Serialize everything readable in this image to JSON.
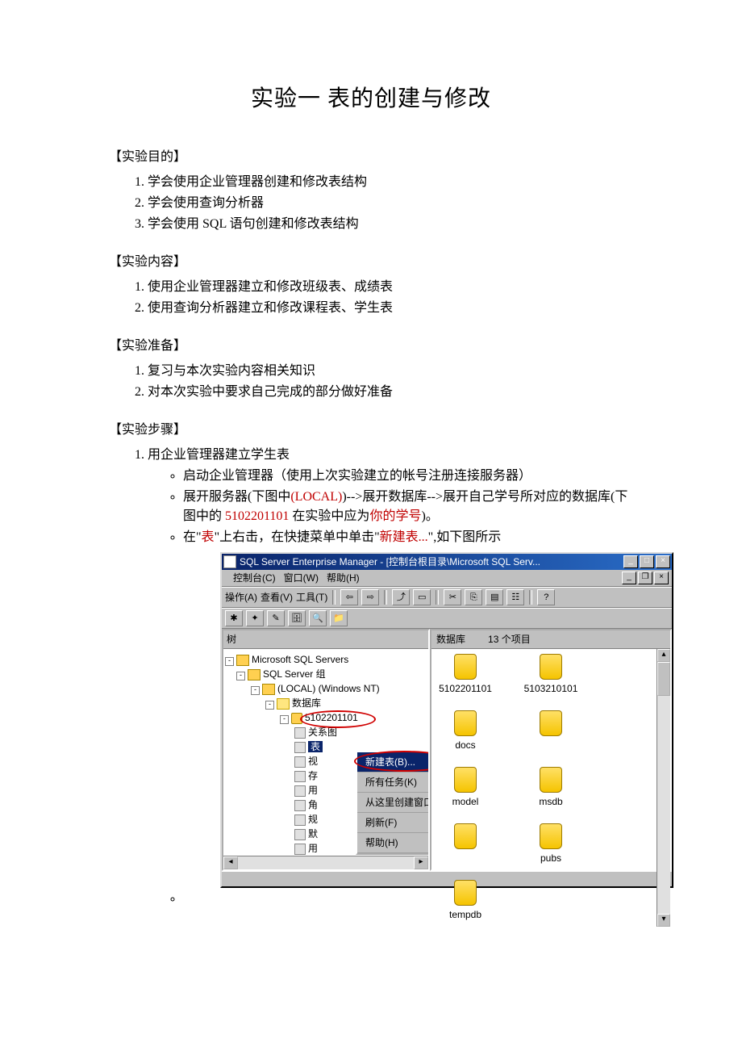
{
  "title": "实验一  表的创建与修改",
  "sections": {
    "purpose_head": "【实验目的】",
    "purpose": [
      "学会使用企业管理器创建和修改表结构",
      "学会使用查询分析器",
      "学会使用 SQL 语句创建和修改表结构"
    ],
    "content_head": "【实验内容】",
    "content": [
      "使用企业管理器建立和修改班级表、成绩表",
      "使用查询分析器建立和修改课程表、学生表"
    ],
    "prep_head": "【实验准备】",
    "prep": [
      "复习与本次实验内容相关知识",
      "对本次实验中要求自己完成的部分做好准备"
    ],
    "steps_head": "【实验步骤】",
    "step1": "用企业管理器建立学生表",
    "sub1": "启动企业管理器（使用上次实验建立的帐号注册连接服务器）",
    "sub2a": "展开服务器(下图中",
    "sub2b": "(LOCAL)",
    "sub2c": ")-->展开数据库-->展开自己学号所对应的数据库(下图中的 ",
    "sub2d": "5102201101",
    "sub2e": " 在实验中应为",
    "sub2f": "你的学号",
    "sub2g": ")。",
    "sub3a": "在\"",
    "sub3b": "表",
    "sub3c": "\"上右击，在快捷菜单中单击\"",
    "sub3d": "新建表...",
    "sub3e": "\",如下图所示"
  },
  "screenshot": {
    "titlebar": "SQL Server Enterprise Manager - [控制台根目录\\Microsoft SQL Serv...",
    "winbtn_min": "_",
    "winbtn_max": "□",
    "winbtn_close": "×",
    "menu": {
      "console": "控制台(C)",
      "window": "窗口(W)",
      "help": "帮助(H)"
    },
    "toolbar": {
      "action": "操作(A)",
      "view": "查看(V)",
      "tools": "工具(T)"
    },
    "tree": {
      "header": "树",
      "root": "Microsoft SQL Servers",
      "group": "SQL Server 组",
      "local": "(LOCAL) (Windows NT)",
      "dbfolder": "数据库",
      "dbname": "5102201101",
      "nodes": {
        "diagram": "关系图",
        "table": "表",
        "view": "视",
        "proc": "存",
        "user": "用",
        "role": "角",
        "rule": "规",
        "default": "默",
        "udt": "用"
      }
    },
    "list": {
      "header_left": "数据库",
      "header_right": "13 个项目",
      "items": [
        "5102201101",
        "5103210101",
        "docs",
        "",
        "model",
        "msdb",
        "",
        "pubs",
        "tempdb"
      ]
    },
    "contextmenu": {
      "newtable": "新建表(B)...",
      "alltasks": "所有任务(K)",
      "createwin": "从这里创建窗口(W)",
      "refresh": "刷新(F)",
      "help": "帮助(H)"
    }
  }
}
